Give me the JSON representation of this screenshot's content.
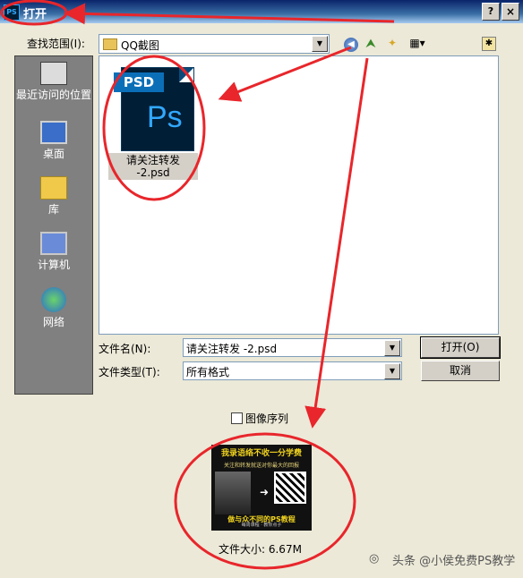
{
  "window": {
    "app_icon": "PS",
    "title": "打开",
    "help_label": "?",
    "close_label": "×"
  },
  "lookin": {
    "label": "查找范围(I):",
    "value": "QQ截图"
  },
  "toolbar": {
    "icons": [
      "back-icon",
      "up-folder-icon",
      "new-folder-icon",
      "view-menu-icon"
    ],
    "extra": "✱"
  },
  "places": [
    {
      "label": "最近访问的位置",
      "icon": "recent-places-icon"
    },
    {
      "label": "桌面",
      "icon": "desktop-icon"
    },
    {
      "label": "库",
      "icon": "library-icon"
    },
    {
      "label": "计算机",
      "icon": "computer-icon"
    },
    {
      "label": "网络",
      "icon": "network-icon"
    }
  ],
  "files": [
    {
      "name": "请关注转发 -2.psd",
      "icon_tag": "PSD",
      "icon_text": "Ps"
    }
  ],
  "filename": {
    "label": "文件名(N):",
    "value": "请关注转发 -2.psd"
  },
  "filetype": {
    "label": "文件类型(T):",
    "value": "所有格式"
  },
  "buttons": {
    "open": "打开(O)",
    "cancel": "取消"
  },
  "image_sequence": {
    "label": "图像序列",
    "checked": false
  },
  "preview": {
    "headline": "我录语络不收一分学费",
    "subline": "关注和转发就送对你最大的回报",
    "bottom": "做与众不同的PS教程",
    "caption": "每周课程 · 教你点子",
    "file_size": "文件大小: 6.67M"
  },
  "watermark": "头条 @小侯免费PS教学",
  "colors": {
    "annotation": "#e8262b",
    "title_bar": "#0a246a",
    "ps_blue": "#31a8ff"
  }
}
